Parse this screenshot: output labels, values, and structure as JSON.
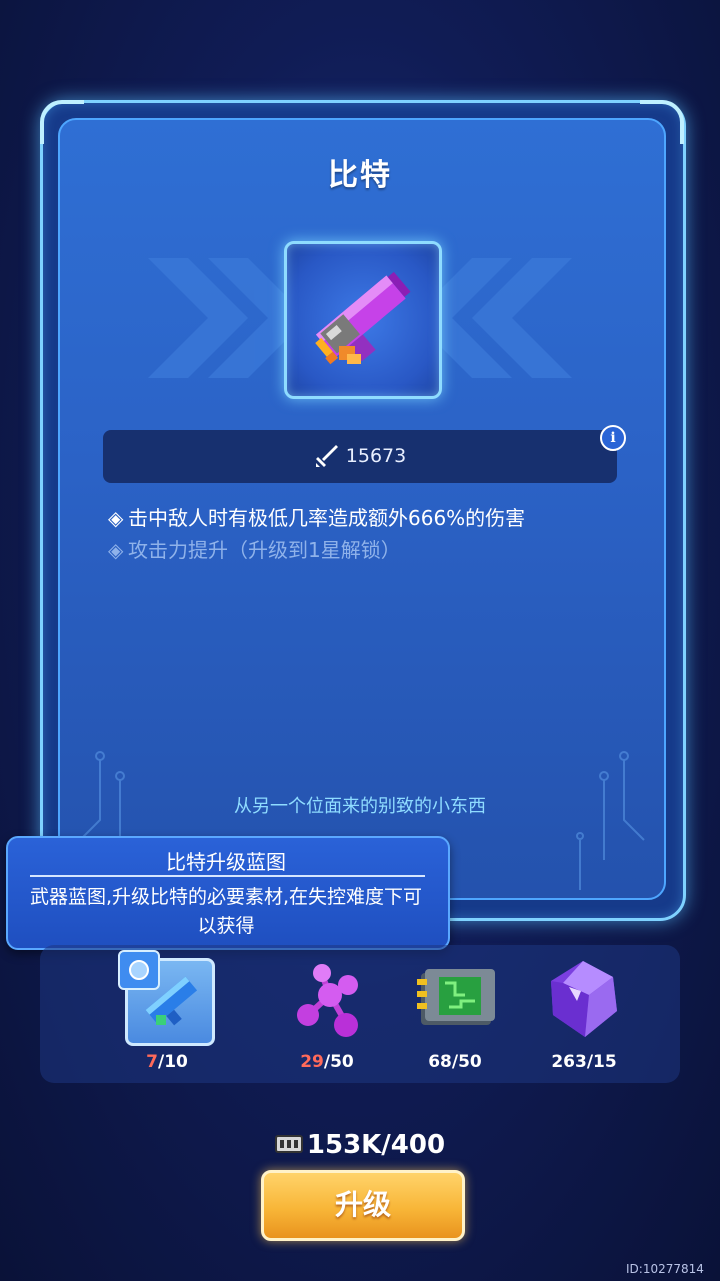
{
  "item": {
    "title": "比特",
    "attack": "15673",
    "perks": [
      "击中敌人时有极低几率造成额外666%的伤害",
      "攻击力提升（升级到1星解锁）"
    ],
    "flavor": "从另一个位面来的别致的小东西",
    "info_symbol": "i",
    "icon": "pixel-gun-icon"
  },
  "tooltip": {
    "title": "比特升级蓝图",
    "description": "武器蓝图,升级比特的必要素材,在失控难度下可以获得"
  },
  "materials": [
    {
      "name": "blueprint",
      "have": "7",
      "need": "/10",
      "insufficient": true
    },
    {
      "name": "purple-molecule",
      "have": "29",
      "need": "/50",
      "insufficient": true
    },
    {
      "name": "circuit-chip",
      "have": "68",
      "need": "/50",
      "insufficient": false
    },
    {
      "name": "purple-gem",
      "have": "263",
      "need": "/15",
      "insufficient": false
    }
  ],
  "cost": {
    "text": "153K/400",
    "icon": "ticket-icon"
  },
  "upgrade_button": "升级",
  "player_id": "ID:10277814",
  "colors": {
    "accent": "#7fd2ff",
    "button": "#f8b638",
    "warning": "#ff6a5a"
  }
}
